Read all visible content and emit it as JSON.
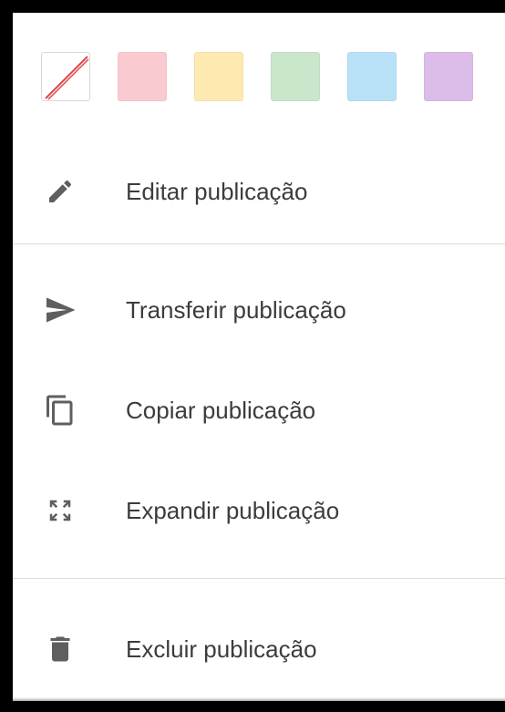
{
  "colors": {
    "swatches": [
      {
        "name": "none",
        "hex": "#ffffff"
      },
      {
        "name": "red",
        "hex": "#f9cbd1"
      },
      {
        "name": "yellow",
        "hex": "#fde9b1"
      },
      {
        "name": "green",
        "hex": "#cae6cb"
      },
      {
        "name": "blue",
        "hex": "#b8e1f7"
      },
      {
        "name": "purple",
        "hex": "#dcbce8"
      }
    ],
    "none_slash": "#e0474c"
  },
  "menu": {
    "edit": {
      "label": "Editar publicação",
      "icon": "pencil-icon"
    },
    "transfer": {
      "label": "Transferir publicação",
      "icon": "send-icon"
    },
    "copy": {
      "label": "Copiar publicação",
      "icon": "copy-icon"
    },
    "expand": {
      "label": "Expandir publicação",
      "icon": "expand-icon"
    },
    "delete": {
      "label": "Excluir publicação",
      "icon": "trash-icon"
    }
  },
  "icon_color": "#5f5f5f"
}
